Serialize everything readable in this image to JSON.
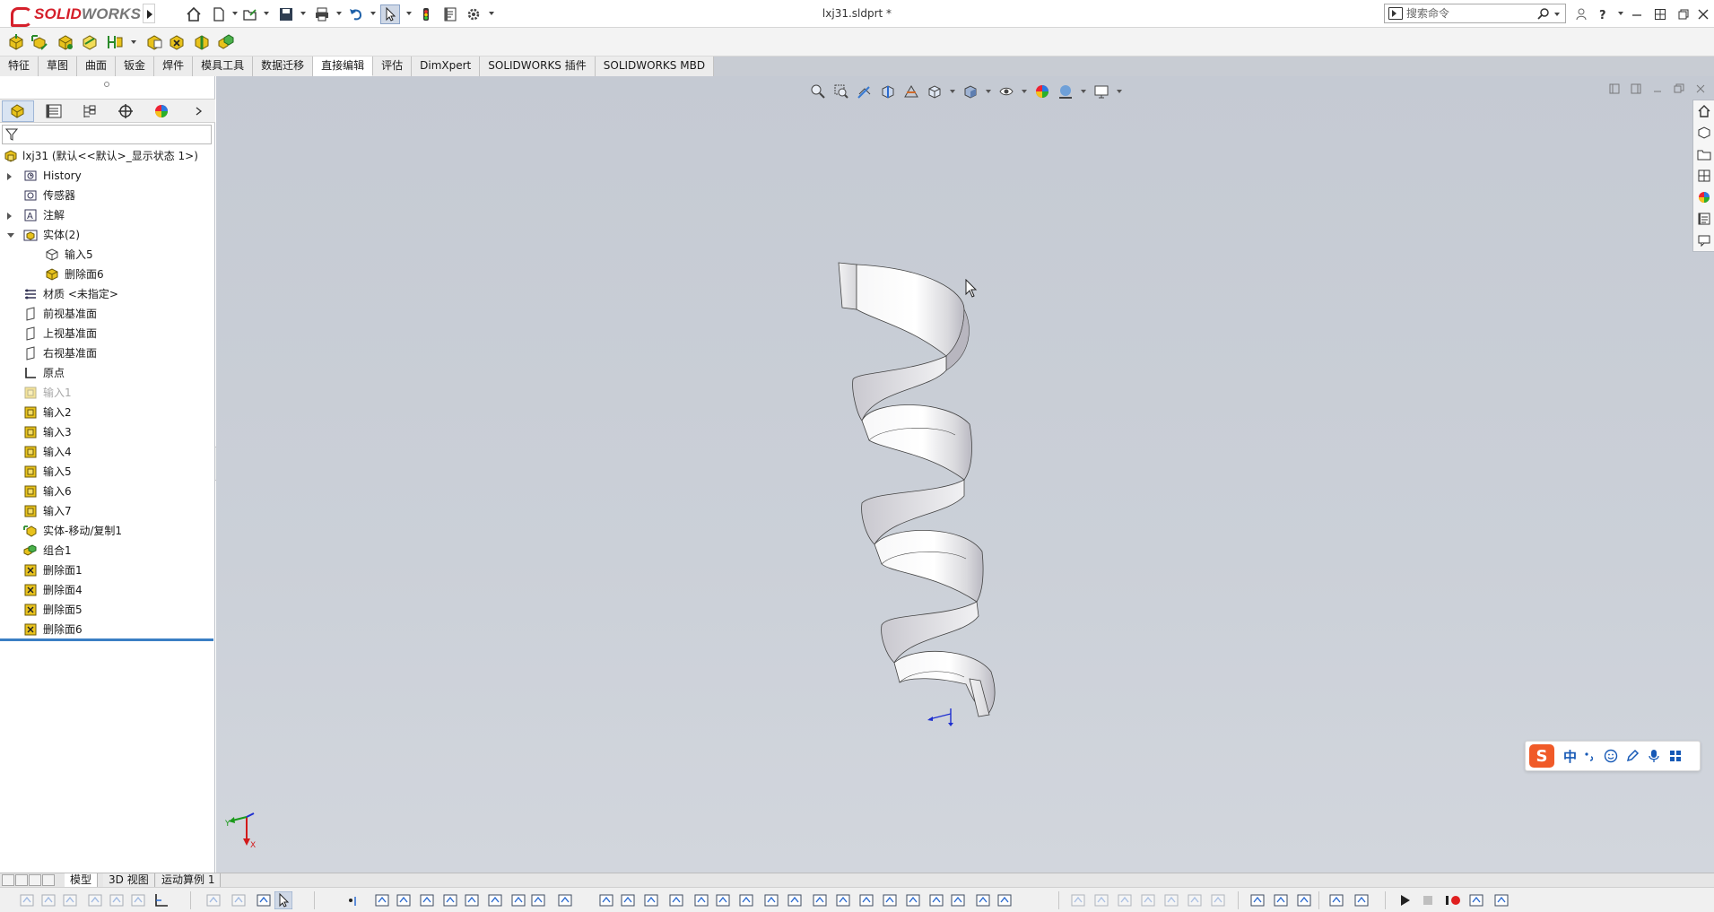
{
  "app": {
    "brand_left": "SOLID",
    "brand_right": "WORKS",
    "document_title": "lxj31.sldprt *"
  },
  "search": {
    "placeholder": "搜索命令"
  },
  "tabs": [
    {
      "label": "特征",
      "active": false
    },
    {
      "label": "草图",
      "active": false
    },
    {
      "label": "曲面",
      "active": false
    },
    {
      "label": "钣金",
      "active": false
    },
    {
      "label": "焊件",
      "active": false
    },
    {
      "label": "模具工具",
      "active": false
    },
    {
      "label": "数据迁移",
      "active": false
    },
    {
      "label": "直接编辑",
      "active": true
    },
    {
      "label": "评估",
      "active": false
    },
    {
      "label": "DimXpert",
      "active": false
    },
    {
      "label": "SOLIDWORKS 插件",
      "active": false
    },
    {
      "label": "SOLIDWORKS MBD",
      "active": false
    }
  ],
  "tree": {
    "root": "lxj31  (默认<<默认>_显示状态 1>)",
    "items": [
      {
        "label": "History",
        "icon": "history-icon",
        "expander": "closed",
        "level": 1,
        "dim": false
      },
      {
        "label": "传感器",
        "icon": "sensor-icon",
        "expander": "none",
        "level": 1,
        "dim": false
      },
      {
        "label": "注解",
        "icon": "annotation-icon",
        "expander": "closed",
        "level": 1,
        "dim": false
      },
      {
        "label": "实体(2)",
        "icon": "solid-bodies-folder-icon",
        "expander": "open",
        "level": 1,
        "dim": false
      },
      {
        "label": "输入5",
        "icon": "body-icon",
        "expander": "none",
        "level": 2,
        "dim": false
      },
      {
        "label": "删除面6",
        "icon": "yellow-body-icon",
        "expander": "none",
        "level": 2,
        "dim": false
      },
      {
        "label": "材质 <未指定>",
        "icon": "material-icon",
        "expander": "none",
        "level": 1,
        "dim": false
      },
      {
        "label": "前视基准面",
        "icon": "plane-icon",
        "expander": "none",
        "level": 1,
        "dim": false
      },
      {
        "label": "上视基准面",
        "icon": "plane-icon",
        "expander": "none",
        "level": 1,
        "dim": false
      },
      {
        "label": "右视基准面",
        "icon": "plane-icon",
        "expander": "none",
        "level": 1,
        "dim": false
      },
      {
        "label": "原点",
        "icon": "origin-icon",
        "expander": "none",
        "level": 1,
        "dim": false
      },
      {
        "label": "输入1",
        "icon": "imported-body-icon",
        "expander": "none",
        "level": 1,
        "dim": true
      },
      {
        "label": "输入2",
        "icon": "imported-body-icon",
        "expander": "none",
        "level": 1,
        "dim": false
      },
      {
        "label": "输入3",
        "icon": "imported-body-icon",
        "expander": "none",
        "level": 1,
        "dim": false
      },
      {
        "label": "输入4",
        "icon": "imported-body-icon",
        "expander": "none",
        "level": 1,
        "dim": false
      },
      {
        "label": "输入5",
        "icon": "imported-body-icon",
        "expander": "none",
        "level": 1,
        "dim": false
      },
      {
        "label": "输入6",
        "icon": "imported-body-icon",
        "expander": "none",
        "level": 1,
        "dim": false
      },
      {
        "label": "输入7",
        "icon": "imported-body-icon",
        "expander": "none",
        "level": 1,
        "dim": false
      },
      {
        "label": "实体-移动/复制1",
        "icon": "move-copy-icon",
        "expander": "none",
        "level": 1,
        "dim": false
      },
      {
        "label": "组合1",
        "icon": "combine-icon",
        "expander": "none",
        "level": 1,
        "dim": false
      },
      {
        "label": "删除面1",
        "icon": "delete-face-icon",
        "expander": "none",
        "level": 1,
        "dim": false
      },
      {
        "label": "删除面4",
        "icon": "delete-face-icon",
        "expander": "none",
        "level": 1,
        "dim": false
      },
      {
        "label": "删除面5",
        "icon": "delete-face-icon",
        "expander": "none",
        "level": 1,
        "dim": false
      },
      {
        "label": "删除面6",
        "icon": "delete-face-icon",
        "expander": "none",
        "level": 1,
        "dim": false
      }
    ]
  },
  "bottom_tabs": [
    {
      "label": "模型",
      "active": true
    },
    {
      "label": "3D 视图",
      "active": false
    },
    {
      "label": "运动算例 1",
      "active": false
    }
  ],
  "ime": {
    "logo": "S",
    "mode": "中"
  },
  "colors": {
    "brand_red": "#d5202b",
    "viewport_bg": "#c8ccd4",
    "model_face": "#e9e9ec",
    "rollback_bar": "#3b7fc4",
    "ime_orange": "#f05a28"
  }
}
